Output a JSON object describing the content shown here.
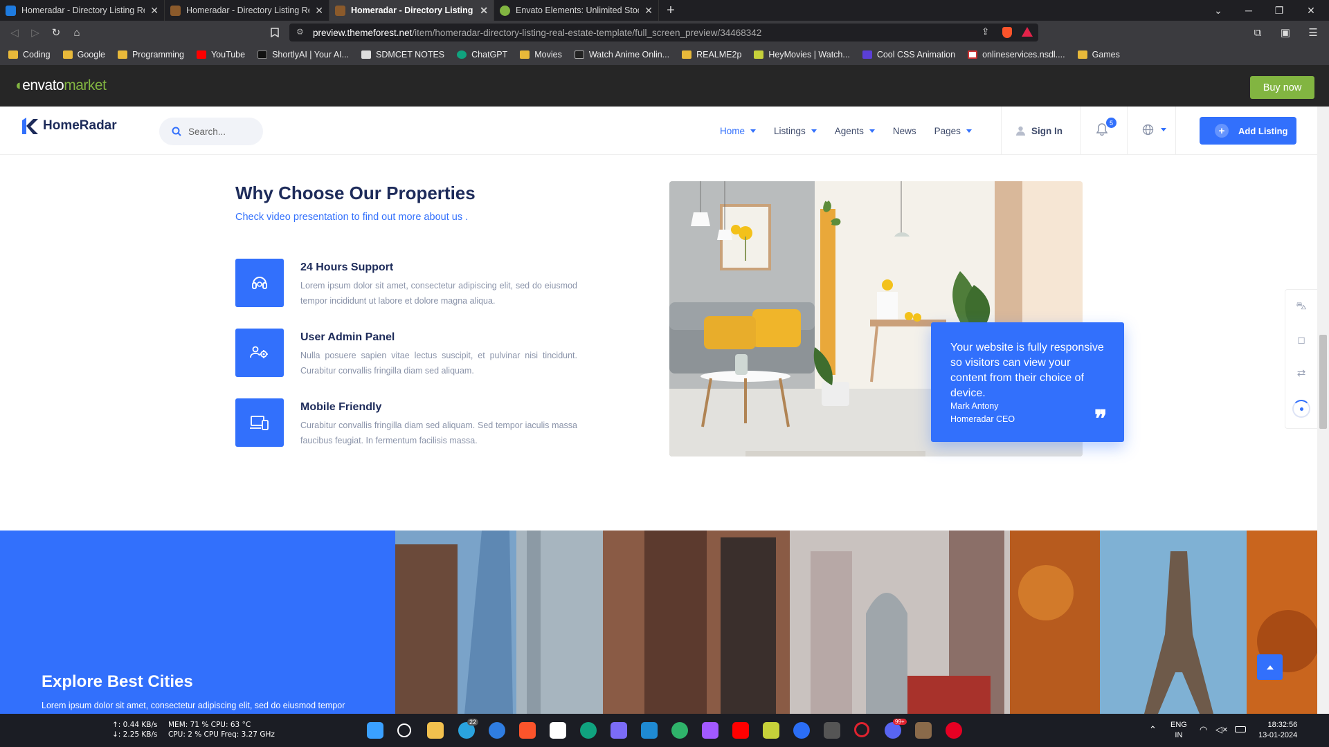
{
  "browser": {
    "tabs": [
      {
        "title": "Homeradar - Directory Listing Real Est",
        "favicon": "#1e7be0"
      },
      {
        "title": "Homeradar - Directory Listing Real Est",
        "favicon": "#8b5a2b"
      },
      {
        "title": "Homeradar - Directory Listing Re",
        "favicon": "#8b5a2b"
      },
      {
        "title": "Envato Elements: Unlimited Stock Vide",
        "favicon": "#82b541"
      }
    ],
    "url_domain": "preview.themeforest.net",
    "url_path": "/item/homeradar-directory-listing-real-estate-template/full_screen_preview/34468342",
    "bookmarks": [
      "Coding",
      "Google",
      "Programming",
      "YouTube",
      "ShortlyAI | Your AI...",
      "SDMCET NOTES",
      "ChatGPT",
      "Movies",
      "Watch Anime Onlin...",
      "REALME2p",
      "HeyMovies | Watch...",
      "Cool CSS Animation",
      "onlineservices.nsdl....",
      "Games"
    ]
  },
  "envato": {
    "logo_main": "envato",
    "logo_suffix": "market",
    "buy_label": "Buy now"
  },
  "site": {
    "logo": "HomeRadar",
    "search_placeholder": "Search...",
    "nav": [
      "Home",
      "Listings",
      "Agents",
      "News",
      "Pages"
    ],
    "sign_in": "Sign In",
    "notif_count": "5",
    "add_listing": "Add Listing"
  },
  "why": {
    "title": "Why Choose Our Properties",
    "subtitle": "Check video presentation to find out more about us .",
    "features": [
      {
        "title": "24 Hours Support",
        "desc": "Lorem ipsum dolor sit amet, consectetur adipiscing elit, sed do eiusmod tempor incididunt ut labore et dolore magna aliqua.",
        "icon": "headset-icon"
      },
      {
        "title": "User Admin Panel",
        "desc": "Nulla posuere sapien vitae lectus suscipit, et pulvinar nisi tincidunt. Curabitur convallis fringilla diam sed aliquam.",
        "icon": "users-gear-icon"
      },
      {
        "title": "Mobile Friendly",
        "desc": "Curabitur convallis fringilla diam sed aliquam. Sed tempor iaculis massa faucibus feugiat. In fermentum facilisis massa.",
        "icon": "devices-icon"
      }
    ],
    "quote": "Your website is fully responsive so visitors can view your content from their choice of device.",
    "quote_name": "Mark Antony",
    "quote_role": "Homeradar CEO"
  },
  "cities": {
    "title": "Explore Best Cities",
    "text": "Lorem ipsum dolor sit amet, consectetur adipiscing elit, sed do eiusmod tempor"
  },
  "taskbar": {
    "net_up": "↑: 0.44 KB/s",
    "net_down": "↓: 2.25 KB/s",
    "mem": "MEM: 71 %  CPU: 63 °C",
    "cpu": "CPU: 2 %    CPU Freq: 3.27 GHz",
    "lang1": "ENG",
    "lang2": "IN",
    "time": "18:32:56",
    "date": "13-01-2024",
    "telegram_badge": "22",
    "discord_badge": "99+"
  },
  "colors": {
    "accent": "#3270fc",
    "envato_green": "#82b541",
    "navy": "#1d2b5a"
  }
}
